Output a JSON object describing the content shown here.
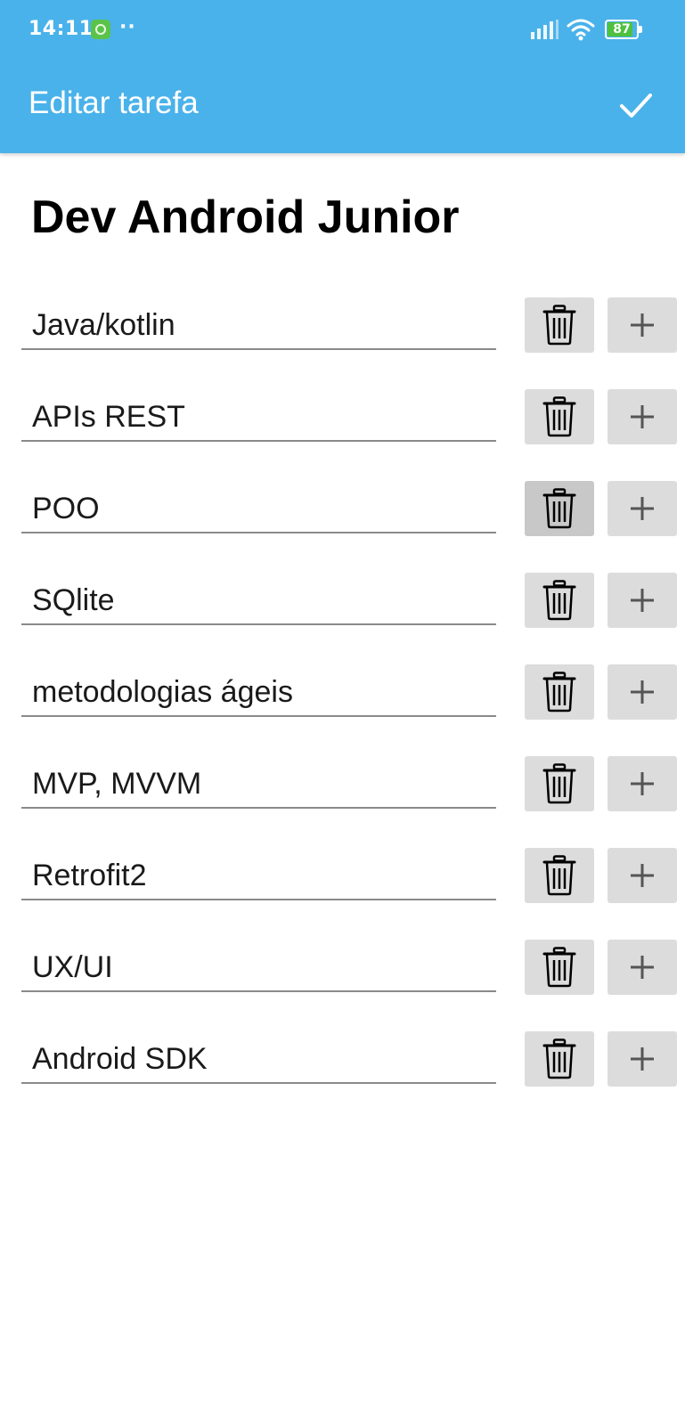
{
  "status_bar": {
    "time": "14:11",
    "notification_dots": "··",
    "battery_level": "87",
    "battery_fraction": 0.87,
    "icons": [
      "app-notification-icon",
      "signal-icon",
      "wifi-icon",
      "battery-icon"
    ]
  },
  "toolbar": {
    "title": "Editar tarefa",
    "confirm_icon": "check-icon",
    "background_color": "#4ab2ea"
  },
  "page": {
    "heading": "Dev Android Junior"
  },
  "tasks": [
    {
      "value": "Java/kotlin"
    },
    {
      "value": "APIs REST"
    },
    {
      "value": "POO"
    },
    {
      "value": "SQlite"
    },
    {
      "value": "metodologias ágeis"
    },
    {
      "value": "MVP, MVVM"
    },
    {
      "value": "Retrofit2"
    },
    {
      "value": "UX/UI"
    },
    {
      "value": "Android SDK"
    }
  ],
  "row_actions": {
    "delete_icon": "trash-icon",
    "add_icon": "plus-icon",
    "button_color": "#dcdcdc"
  }
}
